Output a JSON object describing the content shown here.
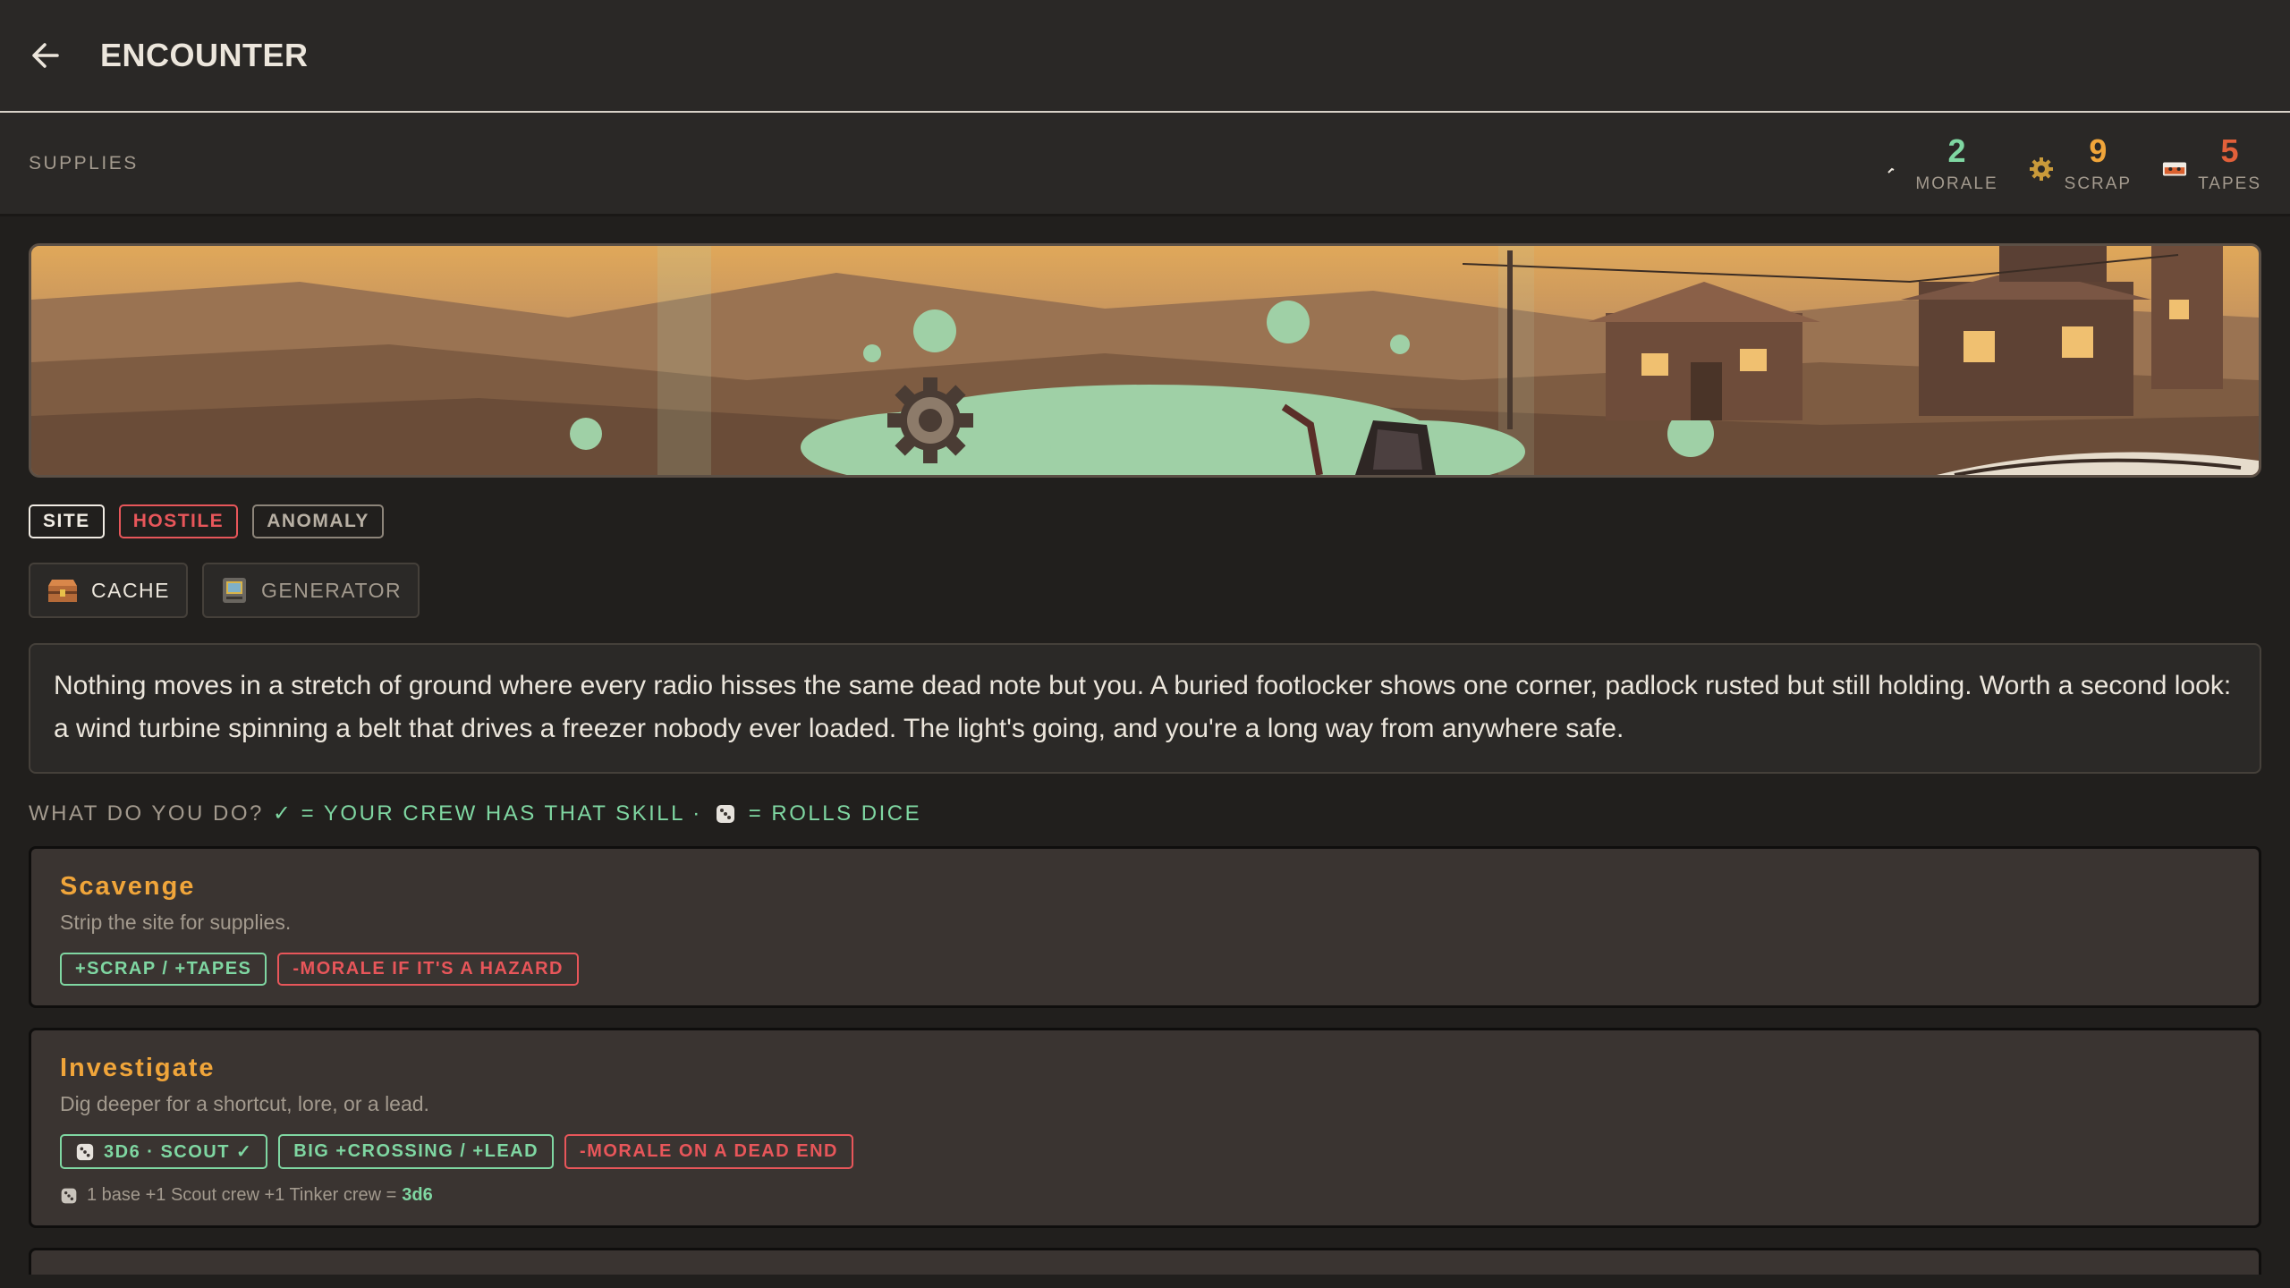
{
  "header": {
    "title": "ENCOUNTER",
    "back_icon": "arrow-left-icon"
  },
  "supplies": {
    "label": "SUPPLIES",
    "stats": [
      {
        "value": "2",
        "label": "MORALE",
        "icon": "morale-icon",
        "color": "#7fd7a2"
      },
      {
        "value": "9",
        "label": "SCRAP",
        "icon": "gear-icon",
        "color": "#f0a53a"
      },
      {
        "value": "5",
        "label": "TAPES",
        "icon": "cassette-tape-icon",
        "color": "#e2603a"
      }
    ]
  },
  "banner": {
    "scene": "pixel-art wasteland with gear, shacks and green fog"
  },
  "tags": [
    "SITE",
    "HOSTILE",
    "ANOMALY"
  ],
  "points_of_interest": [
    {
      "label": "CACHE",
      "icon": "footlocker-icon"
    },
    {
      "label": "GENERATOR",
      "icon": "generator-icon"
    }
  ],
  "description": "Nothing moves in a stretch of ground where every radio hisses the same dead note but you. A buried footlocker shows one corner, padlock rusted but still holding. Worth a second look: a wind turbine spinning a belt that drives a freezer nobody ever loaded. The light's going, and you're a long way from anywhere safe.",
  "prompt": {
    "question": "WHAT DO YOU DO?",
    "legend_skill": "✓ = YOUR CREW HAS THAT SKILL ·",
    "legend_dice": "= ROLLS DICE"
  },
  "choices": [
    {
      "title": "Scavenge",
      "description": "Strip the site for supplies.",
      "chips": [
        {
          "text": "+SCRAP / +TAPES",
          "tone": "green"
        },
        {
          "text": "-MORALE IF IT'S A HAZARD",
          "tone": "red"
        }
      ]
    },
    {
      "title": "Investigate",
      "description": "Dig deeper for a shortcut, lore, or a lead.",
      "chips": [
        {
          "text": "3D6 · SCOUT ✓",
          "tone": "green",
          "dice": true
        },
        {
          "text": "BIG +CROSSING / +LEAD",
          "tone": "green"
        },
        {
          "text": "-MORALE ON A DEAD END",
          "tone": "red"
        }
      ],
      "formula": "1 base +1 Scout crew +1 Tinker crew =",
      "formula_result": "3d6"
    }
  ],
  "colors": {
    "accent_orange": "#f0a53a",
    "accent_green": "#7fd7a2",
    "danger_red": "#e8565a"
  }
}
